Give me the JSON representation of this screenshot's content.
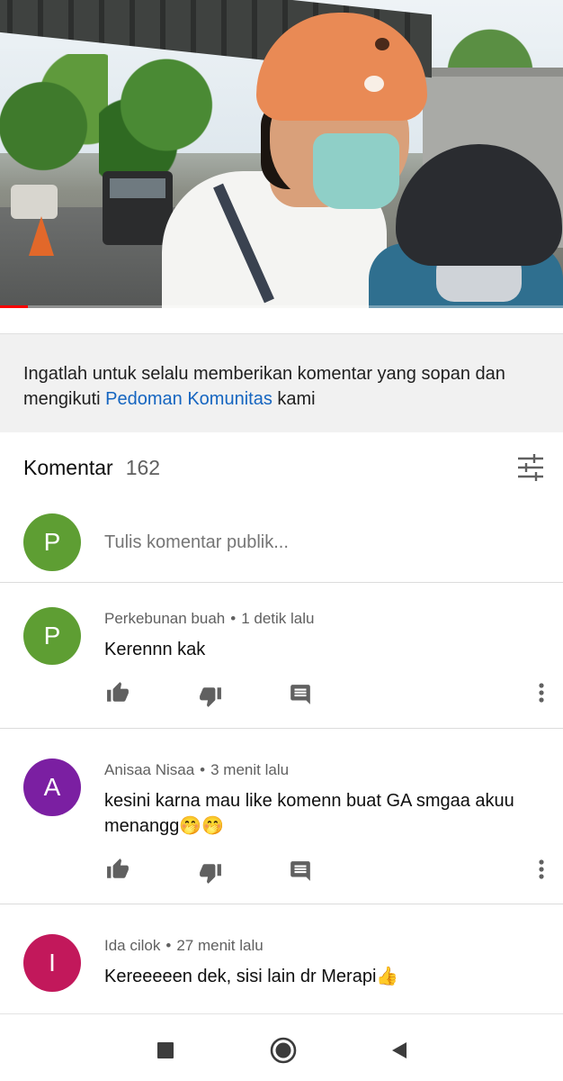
{
  "notice": {
    "text_before": "Ingatlah untuk selalu memberikan komentar yang sopan dan mengikuti ",
    "link": "Pedoman Komunitas",
    "text_after": " kami"
  },
  "comments_header": {
    "title": "Komentar",
    "count": "162",
    "sort_icon": "sort-filter-icon"
  },
  "add_comment": {
    "avatar_letter": "P",
    "avatar_color": "#5e9e33",
    "placeholder": "Tulis komentar publik..."
  },
  "comments": [
    {
      "avatar_letter": "P",
      "avatar_color": "#5e9e33",
      "author": "Perkebunan buah",
      "time": "1 detik lalu",
      "text": "Kerennn kak"
    },
    {
      "avatar_letter": "A",
      "avatar_color": "#7b1fa2",
      "author": "Anisaa Nisaa",
      "time": "3 menit lalu",
      "text": "kesini karna mau like komenn buat GA smgaa akuu menangg🤭🤭"
    },
    {
      "avatar_letter": "I",
      "avatar_color": "#c2185b",
      "author": "Ida cilok",
      "time": "27 menit lalu",
      "text": "Kereeeeen dek, sisi lain dr Merapi👍"
    }
  ],
  "video": {
    "progress_fraction": 0.05
  },
  "icons": {
    "like": "thumb-up-icon",
    "dislike": "thumb-down-icon",
    "reply": "reply-icon",
    "more": "more-vert-icon",
    "nav_recents": "square-icon",
    "nav_home": "circle-icon",
    "nav_back": "triangle-back-icon"
  },
  "colors": {
    "link": "#1565c0",
    "progress": "#ff0000"
  }
}
